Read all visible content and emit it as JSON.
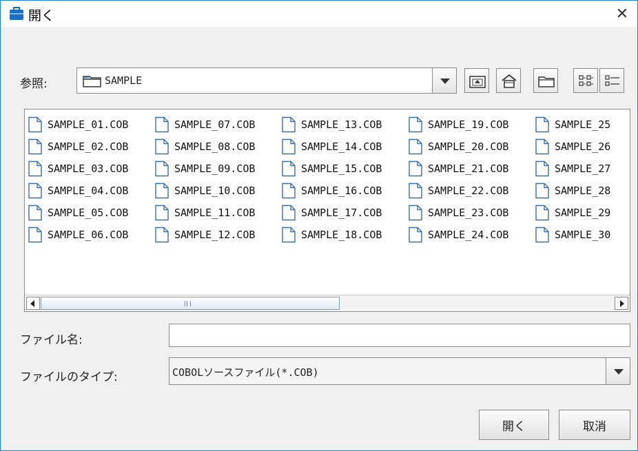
{
  "dialog": {
    "title": "開く",
    "close_glyph": "✕"
  },
  "lookin": {
    "label": "参照:",
    "value": "SAMPLE"
  },
  "toolbar": {
    "icons": [
      "up-folder-icon",
      "home-icon",
      "new-folder-icon",
      "list-view-icon",
      "details-view-icon"
    ]
  },
  "files": {
    "columns": [
      [
        "SAMPLE_01.COB",
        "SAMPLE_02.COB",
        "SAMPLE_03.COB",
        "SAMPLE_04.COB",
        "SAMPLE_05.COB",
        "SAMPLE_06.COB"
      ],
      [
        "SAMPLE_07.COB",
        "SAMPLE_08.COB",
        "SAMPLE_09.COB",
        "SAMPLE_10.COB",
        "SAMPLE_11.COB",
        "SAMPLE_12.COB"
      ],
      [
        "SAMPLE_13.COB",
        "SAMPLE_14.COB",
        "SAMPLE_15.COB",
        "SAMPLE_16.COB",
        "SAMPLE_17.COB",
        "SAMPLE_18.COB"
      ],
      [
        "SAMPLE_19.COB",
        "SAMPLE_20.COB",
        "SAMPLE_21.COB",
        "SAMPLE_22.COB",
        "SAMPLE_23.COB",
        "SAMPLE_24.COB"
      ],
      [
        "SAMPLE_25",
        "SAMPLE_26",
        "SAMPLE_27",
        "SAMPLE_28",
        "SAMPLE_29",
        "SAMPLE_30"
      ]
    ]
  },
  "form": {
    "filename_label": "ファイル名:",
    "filename_value": "",
    "filetype_label": "ファイルのタイプ:",
    "filetype_value": "COBOLソースファイル(*.COB)"
  },
  "buttons": {
    "open": "開く",
    "cancel": "取消"
  },
  "colors": {
    "window_border": "#1e7fd8",
    "title_icon": "#1a6fc4",
    "scroll_thumb": "#dfe9f4"
  }
}
